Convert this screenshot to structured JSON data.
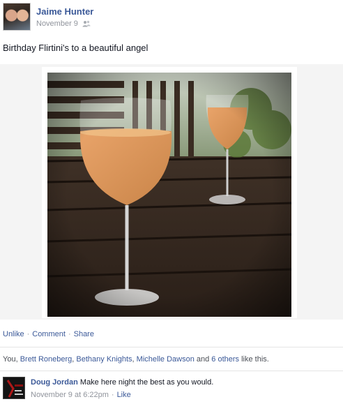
{
  "post": {
    "author": "Jaime Hunter",
    "date": "November 9",
    "audience_icon": "friends-icon",
    "text": "Birthday Flirtini's to a beautiful angel"
  },
  "actions": {
    "unlike": "Unlike",
    "comment": "Comment",
    "share": "Share",
    "separator": "·"
  },
  "likes": {
    "prefix": "You, ",
    "names": [
      "Brett Roneberg",
      "Bethany Knights",
      "Michelle Dawson"
    ],
    "sep1": ", ",
    "sep2": ", ",
    "and": " and ",
    "others": "6 others",
    "suffix": " like this."
  },
  "comment": {
    "author": "Doug Jordan",
    "text": "Make here night the best as you would.",
    "time": "November 9 at 6:22pm",
    "like": "Like",
    "separator": "·"
  },
  "colors": {
    "link": "#3b5998",
    "muted": "#90949c"
  }
}
